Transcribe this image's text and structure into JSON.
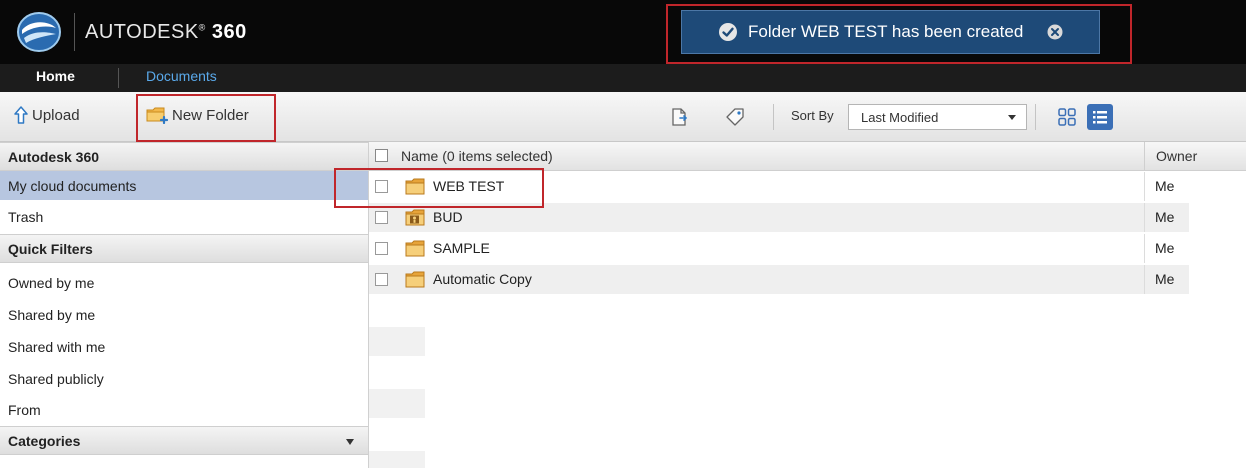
{
  "app": {
    "brand_name": "AUTODESK",
    "brand_suffix": "360"
  },
  "notification": {
    "message": "Folder WEB TEST has been created"
  },
  "nav": {
    "home": "Home",
    "documents": "Documents"
  },
  "toolbar": {
    "upload": "Upload",
    "new_folder": "New Folder",
    "sort_label": "Sort By",
    "sort_value": "Last Modified"
  },
  "sidebar": {
    "section_main": "Autodesk 360",
    "my_cloud": "My cloud documents",
    "trash": "Trash",
    "section_filters": "Quick Filters",
    "owned_by_me": "Owned by me",
    "shared_by_me": "Shared by me",
    "shared_with_me": "Shared with me",
    "shared_publicly": "Shared publicly",
    "from": "From",
    "section_categories": "Categories"
  },
  "list": {
    "name_header": "Name (0 items selected)",
    "owner_header": "Owner",
    "rows": [
      {
        "name": "WEB TEST",
        "owner": "Me",
        "icon": "folder-icon"
      },
      {
        "name": "BUD",
        "owner": "Me",
        "icon": "shared-folder-icon"
      },
      {
        "name": "SAMPLE",
        "owner": "Me",
        "icon": "folder-icon"
      },
      {
        "name": "Automatic Copy",
        "owner": "Me",
        "icon": "folder-icon"
      }
    ]
  },
  "colors": {
    "topbar": "#080808",
    "toast": "#1e4a78",
    "nav_active": "#5aa9ea",
    "selection": "#b7c6e0",
    "highlight": "#c0262b"
  }
}
